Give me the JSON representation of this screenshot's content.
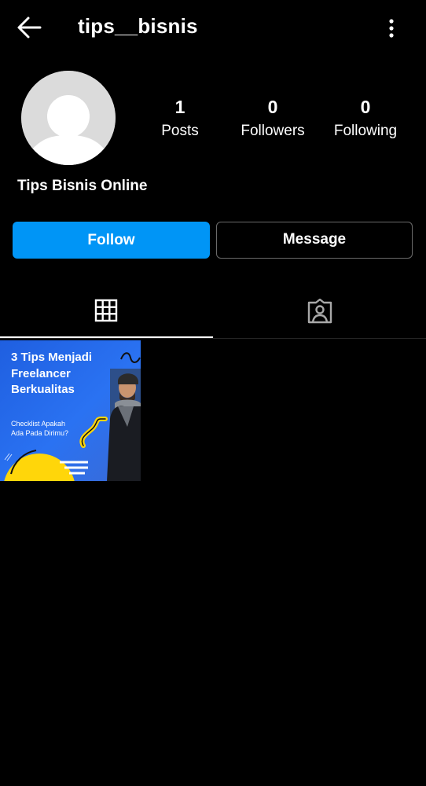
{
  "header": {
    "username": "tips__bisnis",
    "back_icon": "arrow-left-icon",
    "more_icon": "more-vertical-icon"
  },
  "profile": {
    "display_name": "Tips Bisnis Online",
    "avatar": "default-avatar-icon",
    "stats": {
      "posts": {
        "value": "1",
        "label": "Posts"
      },
      "followers": {
        "value": "0",
        "label": "Followers"
      },
      "following": {
        "value": "0",
        "label": "Following"
      }
    }
  },
  "actions": {
    "follow_label": "Follow",
    "message_label": "Message"
  },
  "tabs": [
    {
      "icon": "grid-icon",
      "active": true
    },
    {
      "icon": "tagged-person-icon",
      "active": false
    }
  ],
  "posts": [
    {
      "title": "3 Tips Menjadi Freelancer Berkualitas",
      "subtitle": "Checklist Apakah Ada Pada Dirimu?"
    }
  ],
  "colors": {
    "background": "#000000",
    "accent": "#0095f6",
    "post_blue": "#2a72f2",
    "post_yellow": "#ffd60a"
  }
}
